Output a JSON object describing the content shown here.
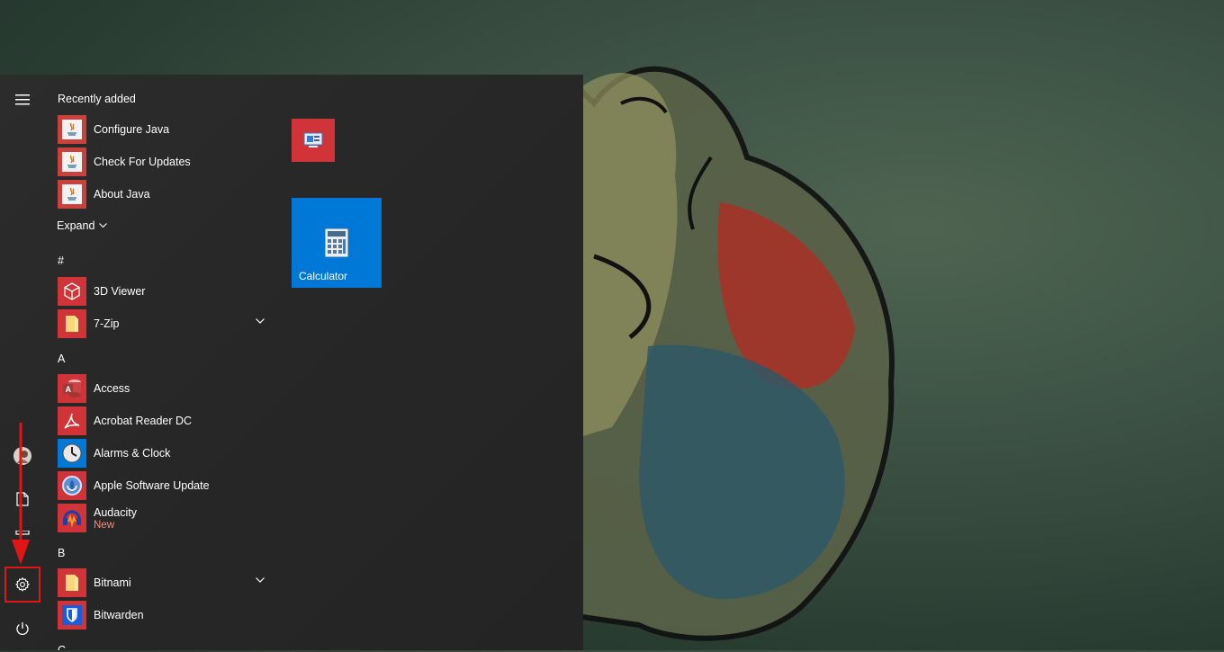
{
  "start_menu": {
    "rail": {
      "menu_icon": "hamburger-icon",
      "user_icon": "user-avatar-icon",
      "documents_icon": "documents-icon",
      "pictures_icon": "pictures-icon",
      "settings_icon": "gear-icon",
      "power_icon": "power-icon"
    },
    "recently_added": {
      "header": "Recently added",
      "items": [
        {
          "label": "Configure Java",
          "icon": "java-icon"
        },
        {
          "label": "Check For Updates",
          "icon": "java-icon"
        },
        {
          "label": "About Java",
          "icon": "java-icon"
        }
      ],
      "expand_label": "Expand"
    },
    "sections": {
      "hash": "#",
      "a": "A",
      "b": "B",
      "c": "C"
    },
    "apps": {
      "viewer3d": {
        "label": "3D Viewer",
        "icon": "3d-viewer-icon"
      },
      "zip7": {
        "label": "7-Zip",
        "icon": "folder-icon"
      },
      "access": {
        "label": "Access",
        "icon": "access-icon"
      },
      "acrobat": {
        "label": "Acrobat Reader DC",
        "icon": "acrobat-icon"
      },
      "alarms": {
        "label": "Alarms & Clock",
        "icon": "clock-icon"
      },
      "apple_update": {
        "label": "Apple Software Update",
        "icon": "apple-update-icon"
      },
      "audacity": {
        "label": "Audacity",
        "sub": "New",
        "icon": "audacity-icon"
      },
      "bitnami": {
        "label": "Bitnami",
        "icon": "folder-icon"
      },
      "bitwarden": {
        "label": "Bitwarden",
        "icon": "bitwarden-icon"
      }
    },
    "tiles": {
      "small_tile_icon": "control-panel-icon",
      "calculator": {
        "label": "Calculator",
        "icon": "calculator-icon"
      }
    }
  },
  "colors": {
    "menu_bg": "#282828",
    "accent_tile": "#0078d7",
    "red_tile": "#d13438",
    "annotation": "#e01515",
    "new_badge": "#ff8a6a"
  }
}
